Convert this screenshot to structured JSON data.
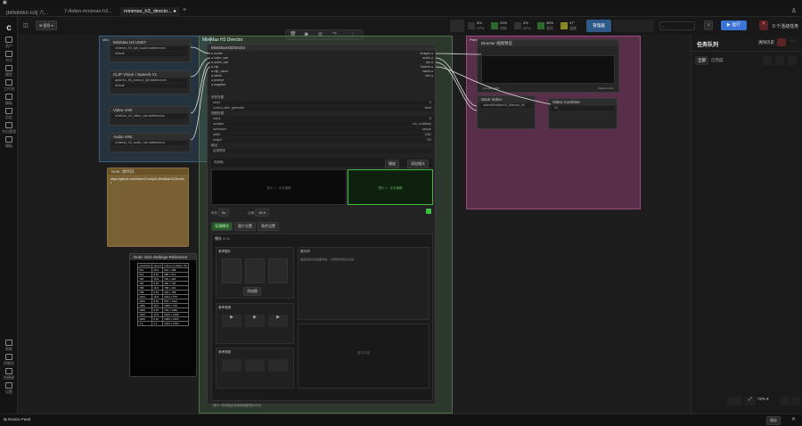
{
  "tabs": [
    "[MINIMAX-H3] 六...",
    "7-Aiden-minimax-h3...",
    "minimax_h3_directo..."
  ],
  "toolbar": {
    "workflow_label": "图形",
    "run_label": "运行",
    "queue_count": "1",
    "active_tasks": "0 个活动任务",
    "manager_label": "管理器",
    "status": [
      {
        "label": "CPU",
        "value": "6%"
      },
      {
        "label": "内存",
        "value": "20%"
      },
      {
        "label": "GPU",
        "value": "3%"
      },
      {
        "label": "显存",
        "value": "36%"
      },
      {
        "label": "温度",
        "value": "47°"
      }
    ]
  },
  "sidebar": [
    {
      "label": "资产",
      "icon": "assets-icon"
    },
    {
      "label": "节点",
      "icon": "nodes-icon"
    },
    {
      "label": "模型",
      "icon": "models-icon"
    },
    {
      "label": "工作流",
      "icon": "workflow-icon"
    },
    {
      "label": "模板",
      "icon": "templates-icon"
    },
    {
      "label": "历史",
      "icon": "history-icon"
    },
    {
      "label": "节点管理",
      "icon": "node-manager-icon"
    },
    {
      "label": "模板",
      "icon": "template2-icon"
    }
  ],
  "sidebar_bottom": [
    {
      "label": "帮助",
      "icon": "help-icon"
    },
    {
      "label": "控制台",
      "icon": "console-icon"
    },
    {
      "label": "快捷键",
      "icon": "keyboard-icon"
    },
    {
      "label": "设置",
      "icon": "settings-icon"
    }
  ],
  "right_panel": {
    "title": "任务队列",
    "clear_label": "清除历史",
    "filters": [
      "全部",
      "已完成"
    ]
  },
  "nodes": {
    "group1": "MiniMax H3 Loaders",
    "unet": {
      "title": "MiniMax H3 UNET",
      "file": "minimax_h3_fp8_scaled.safetensors",
      "dtype": "default"
    },
    "clip": {
      "title": "CLIP Vision / Speech VL",
      "file": "qwen3vl_8b_instruct_fp8.safetensors",
      "type": "default"
    },
    "vae": {
      "title": "Video VAE",
      "file": "minimax_h3_video_vae.safetensors"
    },
    "audio": {
      "title": "Audio VAE",
      "file": "minimax_h3_audio_vae.safetensors"
    },
    "note": {
      "title": "Note: 源代码",
      "text": "https://github.com/Aiden/ComfyUI-MiniMaxH3-Director"
    },
    "director_group": "MiniMax H3 Director",
    "director": {
      "title": "MiniMaxH3Director",
      "inputs": [
        "model",
        "video_vae",
        "audio_vae",
        "clip",
        "clip_vision",
        "latent",
        "prompt",
        "negative"
      ],
      "outputs": [
        "images",
        "audio",
        "fps",
        "frames",
        "latent",
        "info"
      ],
      "widgets": [
        {
          "name": "seed",
          "value": "0"
        },
        {
          "name": "control_after_generate",
          "value": "fixed"
        },
        {
          "name": "steps",
          "value": "8"
        },
        {
          "name": "sampler",
          "value": "res_multistep"
        },
        {
          "name": "scheduler",
          "value": "simple"
        },
        {
          "name": "width",
          "value": "1280"
        },
        {
          "name": "height",
          "value": "720"
        }
      ],
      "section_labels": [
        "采样设置",
        "视频设置",
        "输出"
      ],
      "toggle_label": "启用预览",
      "timeline_label": "时间轴 ",
      "tabs": [
        "导演模式",
        "图片设置",
        "角色设置"
      ],
      "scene_label": "镜头 1",
      "scene_duration": "5s",
      "clip_left": "镜头 1 - 点击编辑",
      "clip_right": "镜头 2 - 点击编辑",
      "ref_image_title": "参考图片",
      "ref_image_btn": "添加图",
      "ref_audio_title": "参考音频",
      "ref_video_title": "参考视频",
      "prompt_title": "提示词",
      "prompt_text": "描述该镜头的画面内容、人物动作和镜头运动...",
      "empty_text": "暂无内容",
      "footer_text": "提示: 时间轴支持拖拽调整镜头时长",
      "duration_label": "时长",
      "duration_value": "5s",
      "ratio_label": "比例",
      "ratio_value": "16:9",
      "play_label": "播放",
      "add_label": "添加镜头"
    },
    "preview_group": "Preview",
    "preview": {
      "title": "Director 视频预览",
      "footer": "preview_0001",
      "frames": "Frames: 121"
    },
    "save": {
      "title": "Save Video",
      "file": "video/MiniMaxH3_Director_00"
    },
    "combine": {
      "title": "Video Combine",
      "fps": "24"
    },
    "table": {
      "title": "Note: Size Settings Reference",
      "headers": [
        "resolution",
        "aspect",
        "output (multiple 16)"
      ],
      "rows": [
        [
          "512",
          "16:9",
          "512 x 288"
        ],
        [
          "512",
          "9:16",
          "288 x 512"
        ],
        [
          "720",
          "16:9",
          "720 x 400"
        ],
        [
          "720",
          "9:16",
          "400 x 720"
        ],
        [
          "768",
          "16:9",
          "768 x 432"
        ],
        [
          "768",
          "9:16",
          "432 x 768"
        ],
        [
          "1024",
          "16:9",
          "1024 x 576"
        ],
        [
          "1024",
          "9:16",
          "576 x 1024"
        ],
        [
          "1280",
          "16:9",
          "1280 x 720"
        ],
        [
          "1280",
          "9:16",
          "720 x 1280"
        ],
        [
          "1920",
          "16:9",
          "1920 x 1080"
        ],
        [
          "1920",
          "9:16",
          "1080 x 1920"
        ],
        [
          "1:1",
          "1:1",
          "1024 x 1024"
        ]
      ]
    }
  },
  "bottom": {
    "left": "Resize Feed",
    "zoom": "72%",
    "save": "保存"
  },
  "colors": {
    "accent": "#3b74d6",
    "group_blue": "#3e5f7a",
    "group_green": "#4e6e4e",
    "group_pink": "#8a3d6b",
    "note_brown": "#7a6133"
  }
}
